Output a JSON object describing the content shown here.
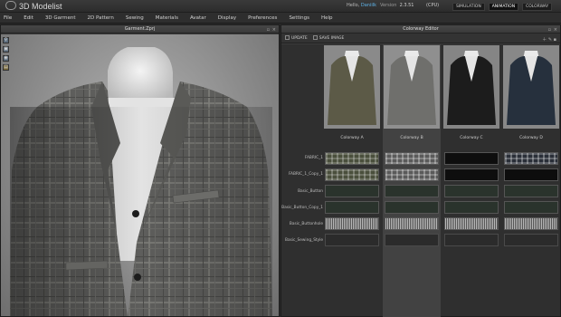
{
  "app": {
    "logo_text": "3D Modelist",
    "user_prefix": "Hello,",
    "user_name": "Daniilk",
    "version_label": "Version",
    "version_value": "2.3.51",
    "cpu_label": "(CPU)",
    "modes": [
      "SIMULATION",
      "ANIMATION",
      "COLORWAY"
    ]
  },
  "menu": [
    "File",
    "Edit",
    "3D Garment",
    "2D Pattern",
    "Sewing",
    "Materials",
    "Avatar",
    "Display",
    "Preferences",
    "Settings",
    "Help"
  ],
  "viewport": {
    "title": "Garment.Zprj"
  },
  "colorway_editor": {
    "title": "Colorway Editor",
    "update_label": "UPDATE",
    "save_image_label": "SAVE IMAGE",
    "colorways": [
      "Colorway A",
      "Colorway B",
      "Colorway C",
      "Colorway D"
    ],
    "selected_colorway": "Colorway B",
    "rows": [
      "FABRIC_1",
      "FABRIC_1_Copy_1",
      "Basic_Button",
      "Basic_Button_Copy_1",
      "Basic_Buttonhole",
      "Basic_Sewing_Style"
    ],
    "jacket_colors": [
      "#5c5a47",
      "#6f6f6c",
      "#1c1c1c",
      "#26303d"
    ]
  }
}
